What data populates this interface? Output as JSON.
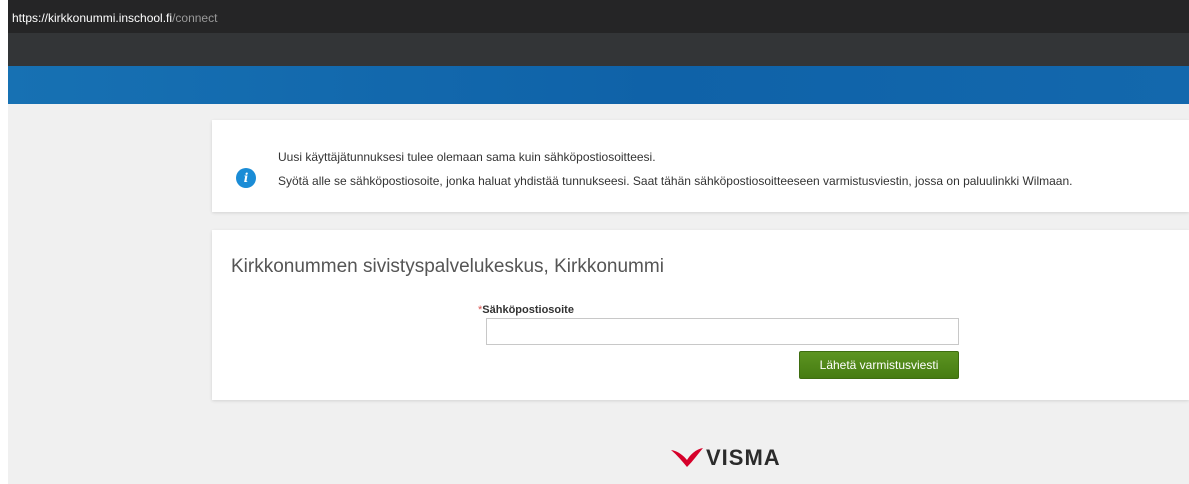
{
  "browser": {
    "url_host": "https://kirkkonummi.inschool.fi",
    "url_path": "/connect"
  },
  "info": {
    "line1": "Uusi käyttäjätunnuksesi tulee olemaan sama kuin sähköpostiosoitteesi.",
    "line2": "Syötä alle se sähköpostiosoite, jonka haluat yhdistää tunnukseesi. Saat tähän sähköpostiosoitteeseen varmistusviestin, jossa on paluulinkki Wilmaan.",
    "icon": "info-icon",
    "icon_glyph": "i"
  },
  "form": {
    "title": "Kirkkonummen sivistyspalvelukeskus, Kirkkonummi",
    "required_mark": "*",
    "email_label": "Sähköpostiosoite",
    "email_value": "",
    "submit_label": "Lähetä varmistusviesti"
  },
  "footer": {
    "logo_text": "VISMA"
  },
  "colors": {
    "brand_bar": "#1771b3",
    "button": "#4f8718",
    "info_icon": "#1a8cd6",
    "logo_red": "#d6002a"
  }
}
